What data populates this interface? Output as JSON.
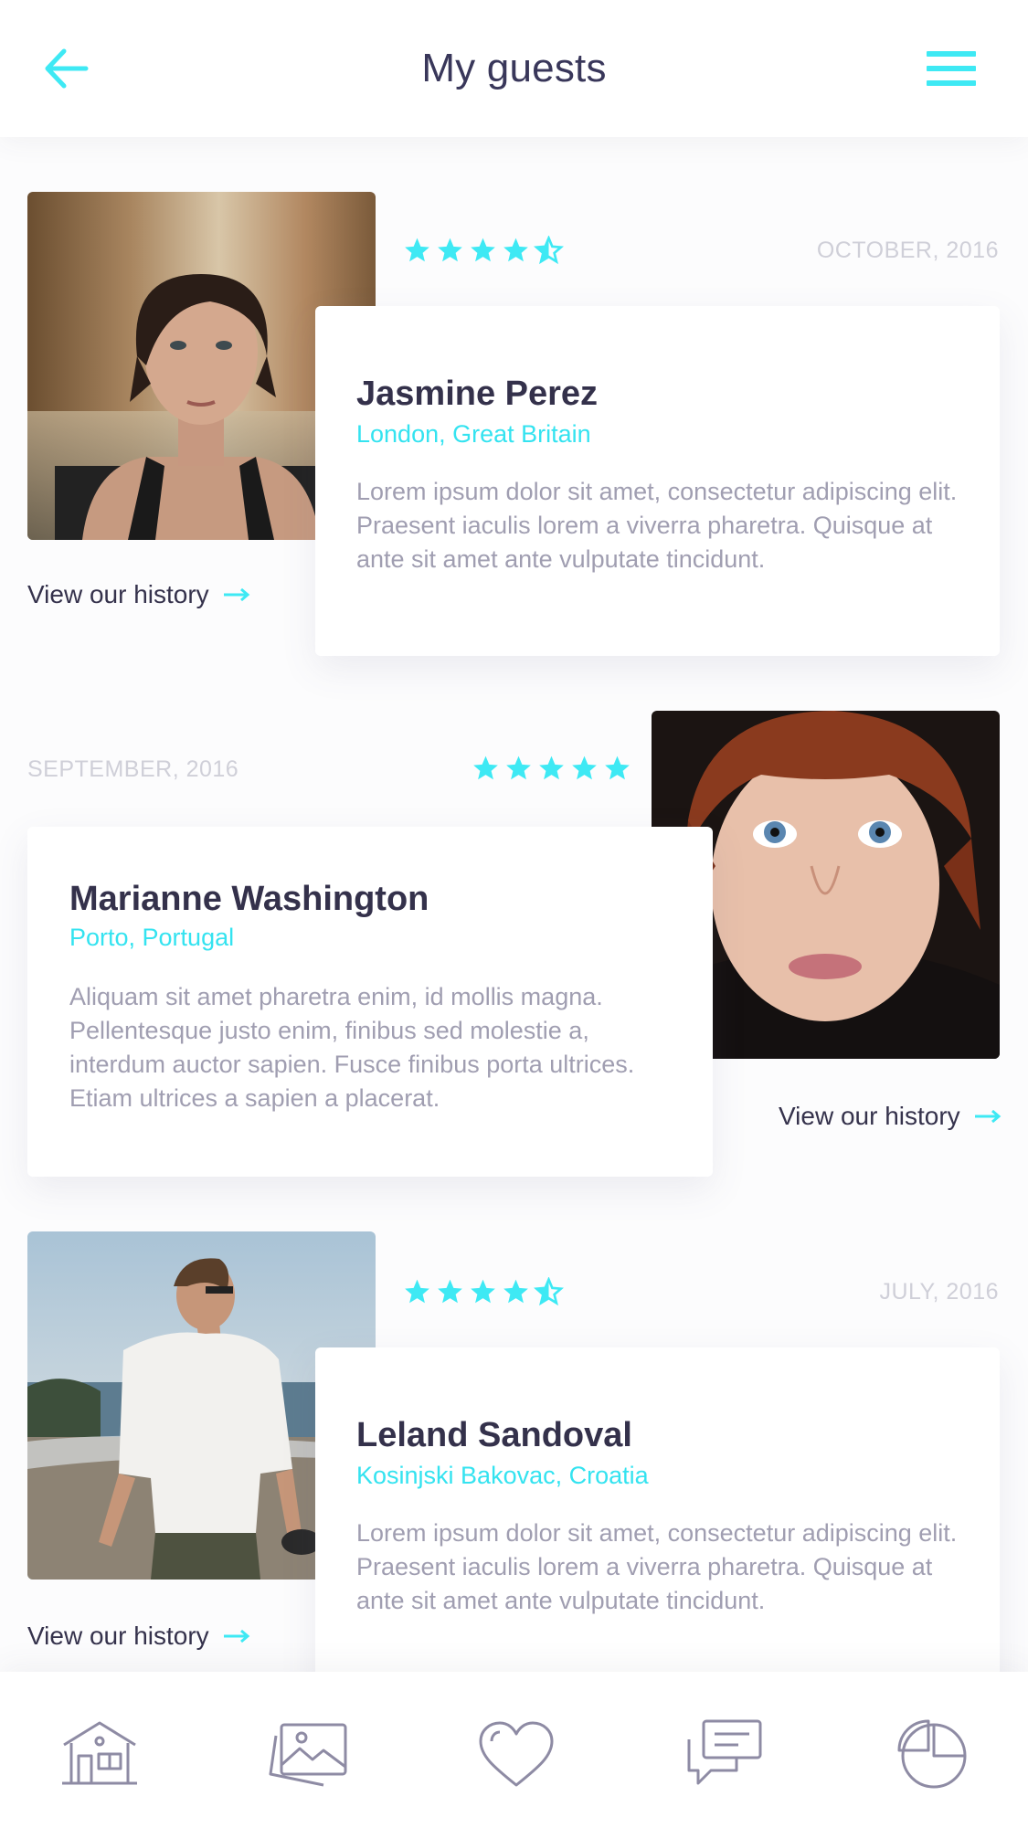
{
  "header": {
    "title": "My guests",
    "back_icon": "arrow-left-icon",
    "menu_icon": "hamburger-menu-icon"
  },
  "colors": {
    "accent": "#3EE9F4",
    "text_dark": "#34314B",
    "text_muted": "#A09EB1",
    "date": "#CFCFD8"
  },
  "guests": [
    {
      "name": "Jasmine Perez",
      "location": "London, Great Britain",
      "date": "OCTOBER, 2016",
      "rating": 4.5,
      "description": "Lorem ipsum dolor sit amet, consectetur adipiscing elit. Praesent iaculis lorem a viverra pharetra. Quisque at ante sit amet ante vulputate tincidunt.",
      "history_label": "View our history"
    },
    {
      "name": "Marianne Washington",
      "location": "Porto, Portugal",
      "date": "SEPTEMBER, 2016",
      "rating": 5,
      "description": "Aliquam sit amet pharetra enim, id mollis magna. Pellentesque justo enim, finibus sed molestie a, interdum auctor sapien. Fusce finibus porta ultrices. Etiam ultrices a sapien a placerat.",
      "history_label": "View our history"
    },
    {
      "name": "Leland Sandoval",
      "location": "Kosinjski Bakovac, Croatia",
      "date": "JULY, 2016",
      "rating": 4.5,
      "description": "Lorem ipsum dolor sit amet, consectetur adipiscing elit. Praesent iaculis lorem a viverra pharetra. Quisque at ante sit amet ante vulputate tincidunt.",
      "history_label": "View our history"
    }
  ],
  "bottom_nav": [
    {
      "icon": "home-icon"
    },
    {
      "icon": "gallery-icon"
    },
    {
      "icon": "heart-icon"
    },
    {
      "icon": "chat-icon"
    },
    {
      "icon": "pie-chart-icon"
    }
  ]
}
